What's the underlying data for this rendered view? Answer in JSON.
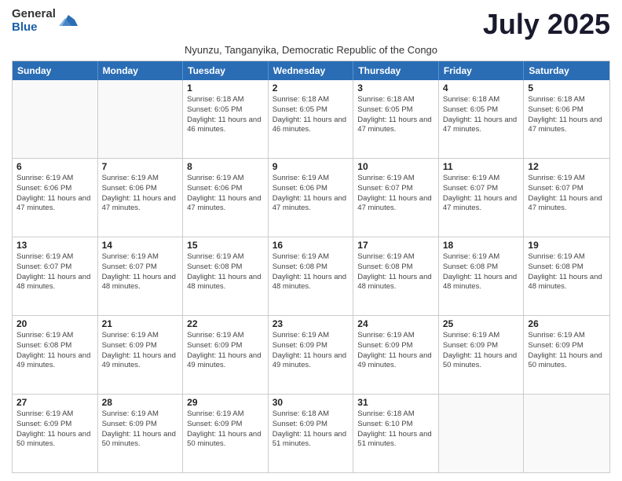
{
  "logo": {
    "general": "General",
    "blue": "Blue"
  },
  "title": "July 2025",
  "subtitle": "Nyunzu, Tanganyika, Democratic Republic of the Congo",
  "header_days": [
    "Sunday",
    "Monday",
    "Tuesday",
    "Wednesday",
    "Thursday",
    "Friday",
    "Saturday"
  ],
  "weeks": [
    [
      {
        "day": "",
        "info": ""
      },
      {
        "day": "",
        "info": ""
      },
      {
        "day": "1",
        "info": "Sunrise: 6:18 AM\nSunset: 6:05 PM\nDaylight: 11 hours and 46 minutes."
      },
      {
        "day": "2",
        "info": "Sunrise: 6:18 AM\nSunset: 6:05 PM\nDaylight: 11 hours and 46 minutes."
      },
      {
        "day": "3",
        "info": "Sunrise: 6:18 AM\nSunset: 6:05 PM\nDaylight: 11 hours and 47 minutes."
      },
      {
        "day": "4",
        "info": "Sunrise: 6:18 AM\nSunset: 6:05 PM\nDaylight: 11 hours and 47 minutes."
      },
      {
        "day": "5",
        "info": "Sunrise: 6:18 AM\nSunset: 6:06 PM\nDaylight: 11 hours and 47 minutes."
      }
    ],
    [
      {
        "day": "6",
        "info": "Sunrise: 6:19 AM\nSunset: 6:06 PM\nDaylight: 11 hours and 47 minutes."
      },
      {
        "day": "7",
        "info": "Sunrise: 6:19 AM\nSunset: 6:06 PM\nDaylight: 11 hours and 47 minutes."
      },
      {
        "day": "8",
        "info": "Sunrise: 6:19 AM\nSunset: 6:06 PM\nDaylight: 11 hours and 47 minutes."
      },
      {
        "day": "9",
        "info": "Sunrise: 6:19 AM\nSunset: 6:06 PM\nDaylight: 11 hours and 47 minutes."
      },
      {
        "day": "10",
        "info": "Sunrise: 6:19 AM\nSunset: 6:07 PM\nDaylight: 11 hours and 47 minutes."
      },
      {
        "day": "11",
        "info": "Sunrise: 6:19 AM\nSunset: 6:07 PM\nDaylight: 11 hours and 47 minutes."
      },
      {
        "day": "12",
        "info": "Sunrise: 6:19 AM\nSunset: 6:07 PM\nDaylight: 11 hours and 47 minutes."
      }
    ],
    [
      {
        "day": "13",
        "info": "Sunrise: 6:19 AM\nSunset: 6:07 PM\nDaylight: 11 hours and 48 minutes."
      },
      {
        "day": "14",
        "info": "Sunrise: 6:19 AM\nSunset: 6:07 PM\nDaylight: 11 hours and 48 minutes."
      },
      {
        "day": "15",
        "info": "Sunrise: 6:19 AM\nSunset: 6:08 PM\nDaylight: 11 hours and 48 minutes."
      },
      {
        "day": "16",
        "info": "Sunrise: 6:19 AM\nSunset: 6:08 PM\nDaylight: 11 hours and 48 minutes."
      },
      {
        "day": "17",
        "info": "Sunrise: 6:19 AM\nSunset: 6:08 PM\nDaylight: 11 hours and 48 minutes."
      },
      {
        "day": "18",
        "info": "Sunrise: 6:19 AM\nSunset: 6:08 PM\nDaylight: 11 hours and 48 minutes."
      },
      {
        "day": "19",
        "info": "Sunrise: 6:19 AM\nSunset: 6:08 PM\nDaylight: 11 hours and 48 minutes."
      }
    ],
    [
      {
        "day": "20",
        "info": "Sunrise: 6:19 AM\nSunset: 6:08 PM\nDaylight: 11 hours and 49 minutes."
      },
      {
        "day": "21",
        "info": "Sunrise: 6:19 AM\nSunset: 6:09 PM\nDaylight: 11 hours and 49 minutes."
      },
      {
        "day": "22",
        "info": "Sunrise: 6:19 AM\nSunset: 6:09 PM\nDaylight: 11 hours and 49 minutes."
      },
      {
        "day": "23",
        "info": "Sunrise: 6:19 AM\nSunset: 6:09 PM\nDaylight: 11 hours and 49 minutes."
      },
      {
        "day": "24",
        "info": "Sunrise: 6:19 AM\nSunset: 6:09 PM\nDaylight: 11 hours and 49 minutes."
      },
      {
        "day": "25",
        "info": "Sunrise: 6:19 AM\nSunset: 6:09 PM\nDaylight: 11 hours and 50 minutes."
      },
      {
        "day": "26",
        "info": "Sunrise: 6:19 AM\nSunset: 6:09 PM\nDaylight: 11 hours and 50 minutes."
      }
    ],
    [
      {
        "day": "27",
        "info": "Sunrise: 6:19 AM\nSunset: 6:09 PM\nDaylight: 11 hours and 50 minutes."
      },
      {
        "day": "28",
        "info": "Sunrise: 6:19 AM\nSunset: 6:09 PM\nDaylight: 11 hours and 50 minutes."
      },
      {
        "day": "29",
        "info": "Sunrise: 6:19 AM\nSunset: 6:09 PM\nDaylight: 11 hours and 50 minutes."
      },
      {
        "day": "30",
        "info": "Sunrise: 6:18 AM\nSunset: 6:09 PM\nDaylight: 11 hours and 51 minutes."
      },
      {
        "day": "31",
        "info": "Sunrise: 6:18 AM\nSunset: 6:10 PM\nDaylight: 11 hours and 51 minutes."
      },
      {
        "day": "",
        "info": ""
      },
      {
        "day": "",
        "info": ""
      }
    ]
  ]
}
